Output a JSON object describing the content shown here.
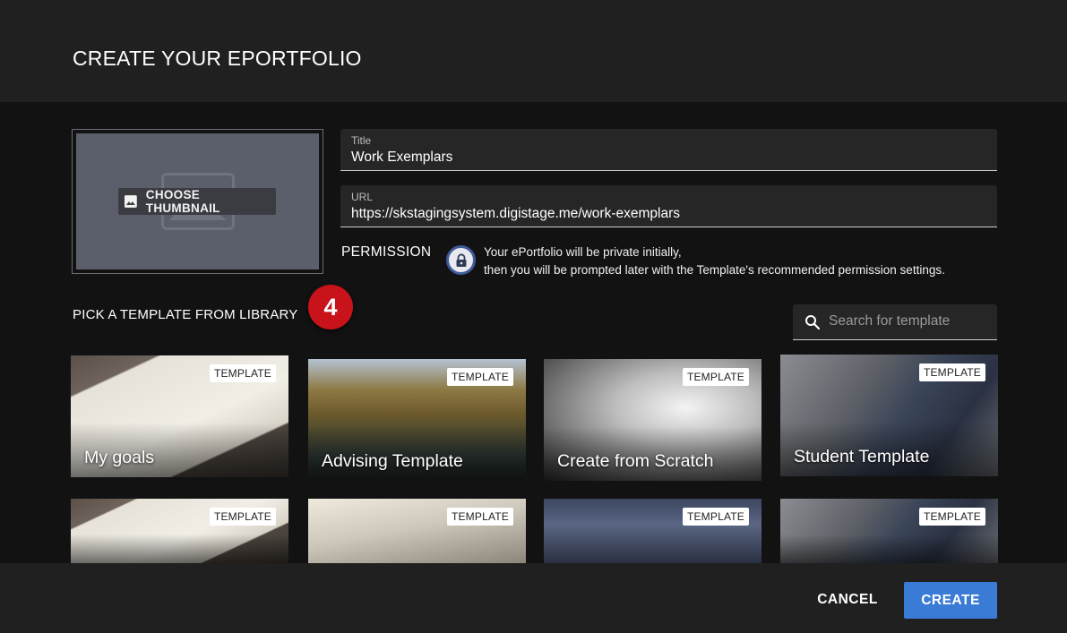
{
  "header": {
    "title": "CREATE YOUR EPORTFOLIO"
  },
  "thumbnail": {
    "button_label": "CHOOSE THUMBNAIL"
  },
  "form": {
    "title": {
      "label": "Title",
      "value": "Work Exemplars"
    },
    "url": {
      "label": "URL",
      "value": "https://skstagingsystem.digistage.me/work-exemplars"
    }
  },
  "permission": {
    "label": "PERMISSION",
    "line1": "Your ePortfolio will be private initially,",
    "line2": "then you will be prompted later with the Template's recommended permission settings."
  },
  "library": {
    "title": "PICK A TEMPLATE FROM LIBRARY",
    "step_number": "4",
    "search_placeholder": "Search for template",
    "tag_label": "TEMPLATE",
    "cards": [
      {
        "title": "My goals"
      },
      {
        "title": "Advising Template"
      },
      {
        "title": "Create from Scratch"
      },
      {
        "title": "Student Template"
      },
      {
        "title": ""
      },
      {
        "title": ""
      },
      {
        "title": ""
      },
      {
        "title": ""
      }
    ]
  },
  "footer": {
    "cancel_label": "CANCEL",
    "create_label": "CREATE"
  },
  "colors": {
    "accent": "#3a7bd5",
    "badge": "#c8131b",
    "header_bg": "#202020",
    "body_bg": "#121212"
  }
}
